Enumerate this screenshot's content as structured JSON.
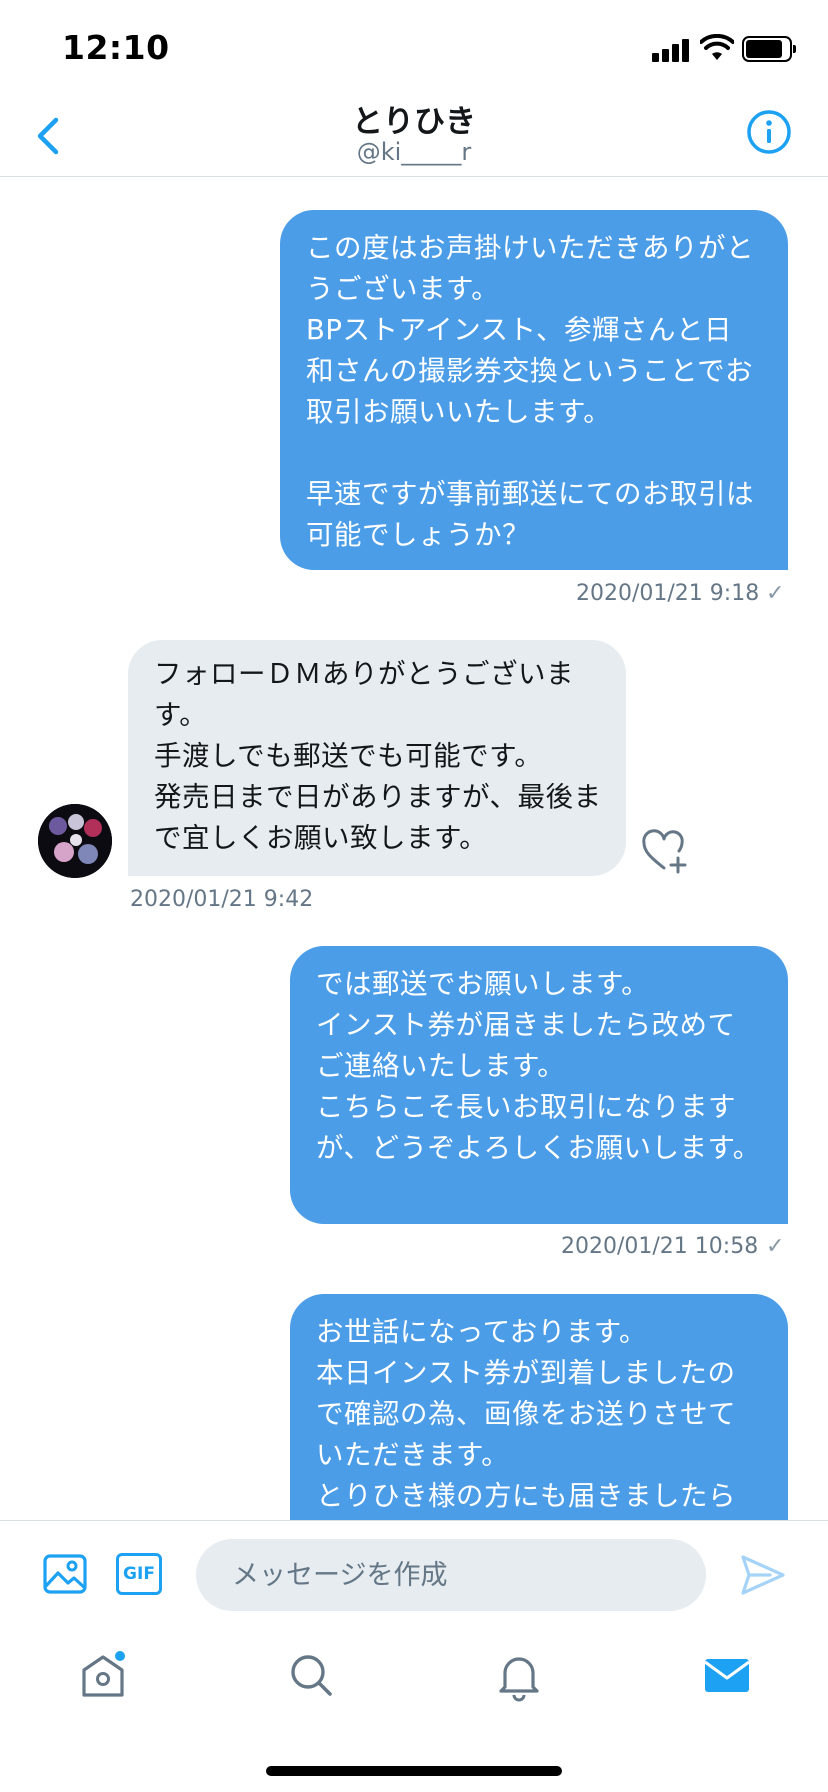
{
  "status_bar": {
    "time": "12:10"
  },
  "header": {
    "title": "とりひき",
    "handle": "@ki_____r"
  },
  "messages": [
    {
      "direction": "sent",
      "text": "この度はお声掛けいただきありがとうございます。\nBPストアインスト、参輝さんと日和さんの撮影券交換ということでお取引お願いいたします。\n\n早速ですが事前郵送にてのお取引は可能でしょうか？",
      "timestamp": "2020/01/21 9:18",
      "read_mark": "✓"
    },
    {
      "direction": "received",
      "text": "フォローＤＭありがとうございます。\n手渡しでも郵送でも可能です。\n発売日まで日がありますが、最後まで宜しくお願い致します。",
      "timestamp": "2020/01/21 9:42"
    },
    {
      "direction": "sent",
      "text": "では郵送でお願いします。\nインスト券が届きましたら改めてご連絡いたします。\nこちらこそ長いお取引になりますが、どうぞよろしくお願いします。",
      "timestamp": "2020/01/21 10:58",
      "read_mark": "✓"
    },
    {
      "direction": "sent",
      "text": "お世話になっております。\n本日インスト券が到着しましたので確認の為、画像をお送りさせていただきます。\nとりひき様の方にも届きましたら"
    }
  ],
  "composer": {
    "placeholder": "メッセージを作成",
    "gif_label": "GIF"
  },
  "colors": {
    "accent": "#1da1f2",
    "sent_bubble": "#4c9de8",
    "received_bubble": "#e6ecf0"
  }
}
